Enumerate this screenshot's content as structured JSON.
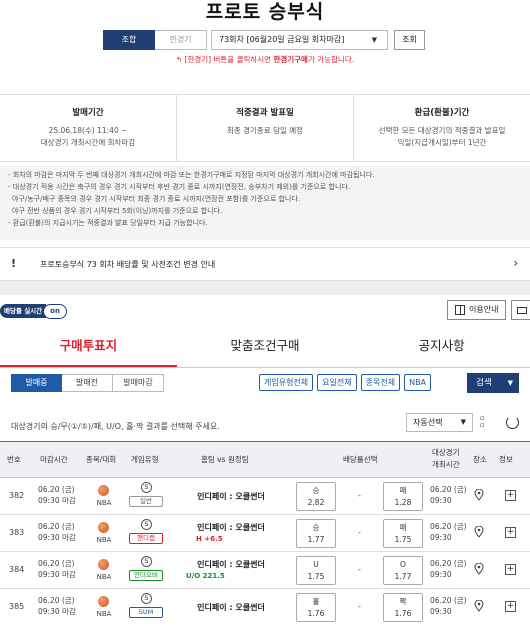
{
  "page": {
    "title": "프로토 승부식",
    "seg_tabs": [
      {
        "label": "조합"
      },
      {
        "label": "한경기"
      }
    ],
    "round_select": "73회차 [06월20일 금요일 회차마감]",
    "search_button": "조회",
    "notice_prefix": "[한경기] 버튼을 클릭하시면 ",
    "notice_bold": "한경기구매",
    "notice_suffix": "가 가능합니다."
  },
  "info": [
    {
      "heading": "발매기간",
      "line1": "25.06.18(수) 11:40 ~",
      "line2": "대상경기 개최시간에 회차마감"
    },
    {
      "heading": "적중결과 발표일",
      "line1": "최종 경기종료 당일 예정",
      "line2": ""
    },
    {
      "heading": "환급(환불)기간",
      "line1": "선택한 모든 대상경기의 적중결과 발표일",
      "line2": "익일(지급개시일)부터 1년간"
    }
  ],
  "rules": [
    "- 회차의 마감은 마지막 두 번째 대상경기 개최시간에 마감 또는 한경기구매로 지정된 마지막 대상경기 개최시간에 마감됩니다.",
    "- 대상경기 적용 시간은 축구의 경우 경기 시작부터 후반 경기 종료 시까지(연장전, 승부차기 제외)를 기준으로 합니다.",
    "  야구/농구/배구 종목의 경우 경기 시작부터 최종 경기 종료 시까지(연장전 포함)를 기준으로 합니다.",
    "  야구 전반 상품의 경우 경기 시작부터 5회(이닝)까지를 기준으로 합니다.",
    "- 환급(환불)의 지급시기는 적중결과 발표 당일부터 지급 가능합니다."
  ],
  "notice_bar": {
    "icon": "!",
    "text": "프로토승부식 73 회차 배당률 및 사전조건 변경 안내"
  },
  "realtime": {
    "label": "배당률 실시간",
    "state": "on"
  },
  "tools": {
    "guide": "이용안내"
  },
  "main_tabs": [
    {
      "label": "구매투표지"
    },
    {
      "label": "맞춤조건구매"
    },
    {
      "label": "공지사항"
    }
  ],
  "status_tabs": [
    {
      "label": "발매중"
    },
    {
      "label": "발매전"
    },
    {
      "label": "발매마감"
    }
  ],
  "filters": [
    {
      "label": "게임유형전체"
    },
    {
      "label": "요일전체"
    },
    {
      "label": "종목전체"
    },
    {
      "label": "NBA"
    }
  ],
  "exec_button": "검색",
  "instruction": "대상경기의 승/무(①/⑤)/패, U/O, 홀·짝 결과를 선택해 주세요.",
  "auto_select": "자동선택",
  "headers": {
    "no": "번호",
    "deadline": "마감시간",
    "sport": "종목/대회",
    "type": "게임유형",
    "match": "홈팀 vs 원정팀",
    "odds": "배당률선택",
    "start1": "대상경기",
    "start2": "개최시간",
    "venue": "장소",
    "info": "정보"
  },
  "rows": [
    {
      "no": "382",
      "d1": "06.20 (금)",
      "d2": "09:30 마감",
      "league": "NBA",
      "sym": "S",
      "type": "일반",
      "home": "인디페이",
      "sep": ":",
      "away": "오클썬더",
      "hval": "",
      "odd1_label": "승",
      "odd1": "2.82",
      "dash": "-",
      "odd2_label": "패",
      "odd2": "1.28",
      "s1": "06.20 (금)",
      "s2": "09:30"
    },
    {
      "no": "383",
      "d1": "06.20 (금)",
      "d2": "09:30 마감",
      "league": "NBA",
      "sym": "S",
      "type": "핸디캡",
      "home": "인디페이",
      "sep": ":",
      "away": "오클썬더",
      "hval": "H +6.5",
      "odd1_label": "승",
      "odd1": "1.77",
      "dash": "-",
      "odd2_label": "패",
      "odd2": "1.75",
      "s1": "06.20 (금)",
      "s2": "09:30"
    },
    {
      "no": "384",
      "d1": "06.20 (금)",
      "d2": "09:30 마감",
      "league": "NBA",
      "sym": "S",
      "type": "언더오버",
      "home": "인디페이",
      "sep": ":",
      "away": "오클썬더",
      "hval": "U/O 221.5",
      "odd1_label": "U",
      "odd1": "1.75",
      "dash": "-",
      "odd2_label": "O",
      "odd2": "1.77",
      "s1": "06.20 (금)",
      "s2": "09:30"
    },
    {
      "no": "385",
      "d1": "06.20 (금)",
      "d2": "09:30 마감",
      "league": "NBA",
      "sym": "S",
      "type": "SUM",
      "home": "인디페이",
      "sep": ":",
      "away": "오클썬더",
      "hval": "",
      "odd1_label": "홀",
      "odd1": "1.76",
      "dash": "-",
      "odd2_label": "짝",
      "odd2": "1.76",
      "s1": "06.20 (금)",
      "s2": "09:30"
    }
  ],
  "colors": {
    "navy": "#1f3f74",
    "blue": "#1f5ba8",
    "red": "#d9232d",
    "green": "#1a8a2a"
  }
}
